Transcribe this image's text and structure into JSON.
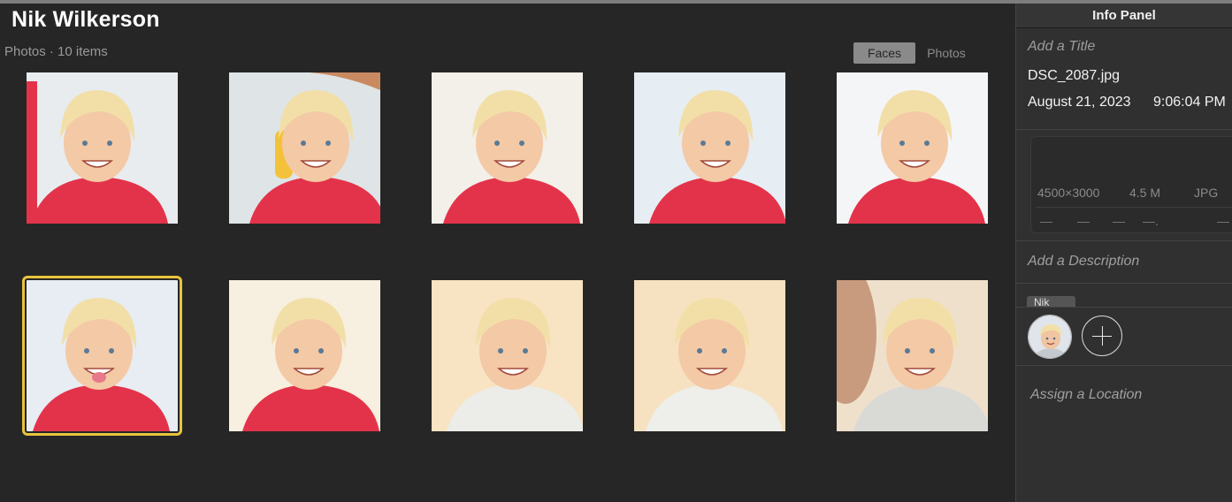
{
  "album": {
    "title": "Nik Wilkerson",
    "subtitle": "Photos · 10 items"
  },
  "view_toggle": {
    "faces_label": "Faces",
    "photos_label": "Photos",
    "selected": "Faces"
  },
  "grid": {
    "selected_index": 5,
    "photos": [
      {
        "scene": "toddler smiling, red shirt, adult arm on left",
        "bg": "#e8ecef"
      },
      {
        "scene": "toddler holding yellow toy, adult hand above",
        "bg": "#dfe4e6"
      },
      {
        "scene": "toddler in profile, red shirt",
        "bg": "#f3efe9"
      },
      {
        "scene": "toddler smiling, red shirt, beach background",
        "bg": "#e6edf3"
      },
      {
        "scene": "toddler portrait, red shirt, light background",
        "bg": "#f4f5f7"
      },
      {
        "scene": "toddler sticking tongue out, red shirt",
        "bg": "#e7edf3"
      },
      {
        "scene": "toddler reaching, red shirt, warm background",
        "bg": "#f7efdf"
      },
      {
        "scene": "toddler laughing, white shirt, held by adult",
        "bg": "#f8e3c2"
      },
      {
        "scene": "toddler big smile, white shirt, sunset",
        "bg": "#f6e2c0"
      },
      {
        "scene": "toddler with adult cheek to cheek",
        "bg": "#efe0cc"
      }
    ]
  },
  "info_panel": {
    "header": "Info Panel",
    "title_placeholder": "Add a Title",
    "filename": "DSC_2087.jpg",
    "date": "August 21, 2023",
    "time": "9:06:04 PM",
    "dimensions": "4500×3000",
    "file_size": "4.5 M",
    "format": "JPG",
    "exif_placeholders": [
      "—",
      "—",
      "—",
      "—.",
      "—"
    ],
    "description_placeholder": "Add a Description",
    "face_tag": "Nik",
    "location_placeholder": "Assign a Location"
  },
  "colors": {
    "background": "#262626",
    "panel": "#303030",
    "selection": "#e8c43c",
    "shirt_red": "#e3334a"
  }
}
